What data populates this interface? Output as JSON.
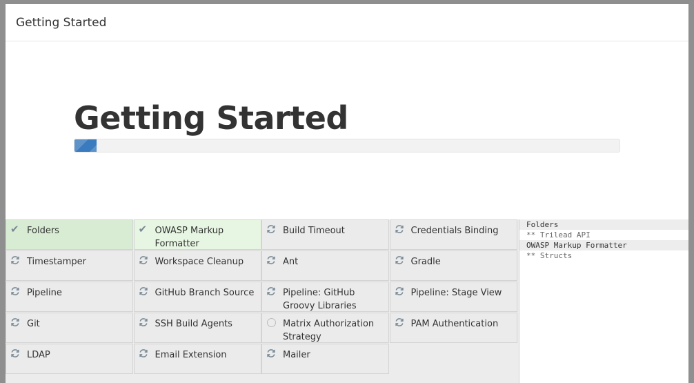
{
  "dialog": {
    "header_title": "Getting Started"
  },
  "hero": {
    "title": "Getting Started",
    "progress_fraction": 0.04
  },
  "plugins": [
    {
      "name": "Folders",
      "status": "success",
      "icon": "check-icon"
    },
    {
      "name": "OWASP Markup Formatter",
      "status": "success",
      "icon": "check-icon"
    },
    {
      "name": "Build Timeout",
      "status": "installing",
      "icon": "refresh-icon"
    },
    {
      "name": "Credentials Binding",
      "status": "installing",
      "icon": "refresh-icon"
    },
    {
      "name": "Timestamper",
      "status": "installing",
      "icon": "refresh-icon"
    },
    {
      "name": "Workspace Cleanup",
      "status": "installing",
      "icon": "refresh-icon"
    },
    {
      "name": "Ant",
      "status": "installing",
      "icon": "refresh-icon"
    },
    {
      "name": "Gradle",
      "status": "installing",
      "icon": "refresh-icon"
    },
    {
      "name": "Pipeline",
      "status": "installing",
      "icon": "refresh-icon"
    },
    {
      "name": "GitHub Branch Source",
      "status": "installing",
      "icon": "refresh-icon"
    },
    {
      "name": "Pipeline: GitHub Groovy Libraries",
      "status": "installing",
      "icon": "refresh-icon"
    },
    {
      "name": "Pipeline: Stage View",
      "status": "installing",
      "icon": "refresh-icon"
    },
    {
      "name": "Git",
      "status": "installing",
      "icon": "refresh-icon"
    },
    {
      "name": "SSH Build Agents",
      "status": "installing",
      "icon": "refresh-icon"
    },
    {
      "name": "Matrix Authorization Strategy",
      "status": "pending",
      "icon": "circle-icon"
    },
    {
      "name": "PAM Authentication",
      "status": "installing",
      "icon": "refresh-icon"
    },
    {
      "name": "LDAP",
      "status": "installing",
      "icon": "refresh-icon"
    },
    {
      "name": "Email Extension",
      "status": "installing",
      "icon": "refresh-icon"
    },
    {
      "name": "Mailer",
      "status": "installing",
      "icon": "refresh-icon"
    }
  ],
  "install_log": [
    {
      "text": "Folders",
      "highlight": true
    },
    {
      "text": "** Trilead API",
      "highlight": false
    },
    {
      "text": "OWASP Markup Formatter",
      "highlight": true
    },
    {
      "text": "** Structs",
      "highlight": false
    }
  ],
  "colors": {
    "success": "#d7ecd2",
    "success_light": "#e7f6e2",
    "progress": "#3a7bbf",
    "check": "#2e7d32"
  }
}
